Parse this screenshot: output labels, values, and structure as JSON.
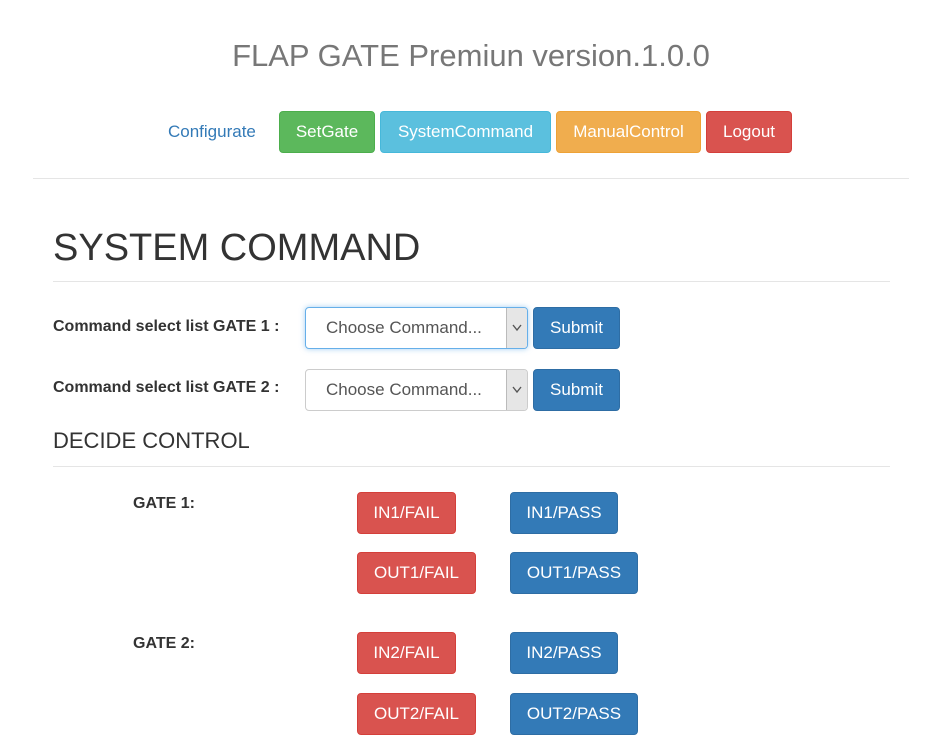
{
  "header": {
    "title": "FLAP GATE Premiun version.1.0.0",
    "nav": {
      "configurate": "Configurate",
      "setgate": "SetGate",
      "system_command": "SystemCommand",
      "manual_control": "ManualControl",
      "logout": "Logout"
    }
  },
  "main": {
    "title": "SYSTEM COMMAND",
    "commands": [
      {
        "label": "Command select list GATE 1 :",
        "selected": "Choose Command...",
        "submit": "Submit"
      },
      {
        "label": "Command select list GATE 2 :",
        "selected": "Choose Command...",
        "submit": "Submit"
      }
    ],
    "decide": {
      "title": "DECIDE CONTROL",
      "gates": [
        {
          "label": "GATE 1:",
          "in_fail": "IN1/FAIL",
          "in_pass": "IN1/PASS",
          "out_fail": "OUT1/FAIL",
          "out_pass": "OUT1/PASS"
        },
        {
          "label": "GATE 2:",
          "in_fail": "IN2/FAIL",
          "in_pass": "IN2/PASS",
          "out_fail": "OUT2/FAIL",
          "out_pass": "OUT2/PASS"
        }
      ]
    }
  },
  "colors": {
    "primary": "#337ab7",
    "success": "#5cb85c",
    "info": "#5bc0de",
    "warning": "#f0ad4e",
    "danger": "#d9534f"
  },
  "icons": {
    "select_arrow": "chevron-down-icon"
  }
}
